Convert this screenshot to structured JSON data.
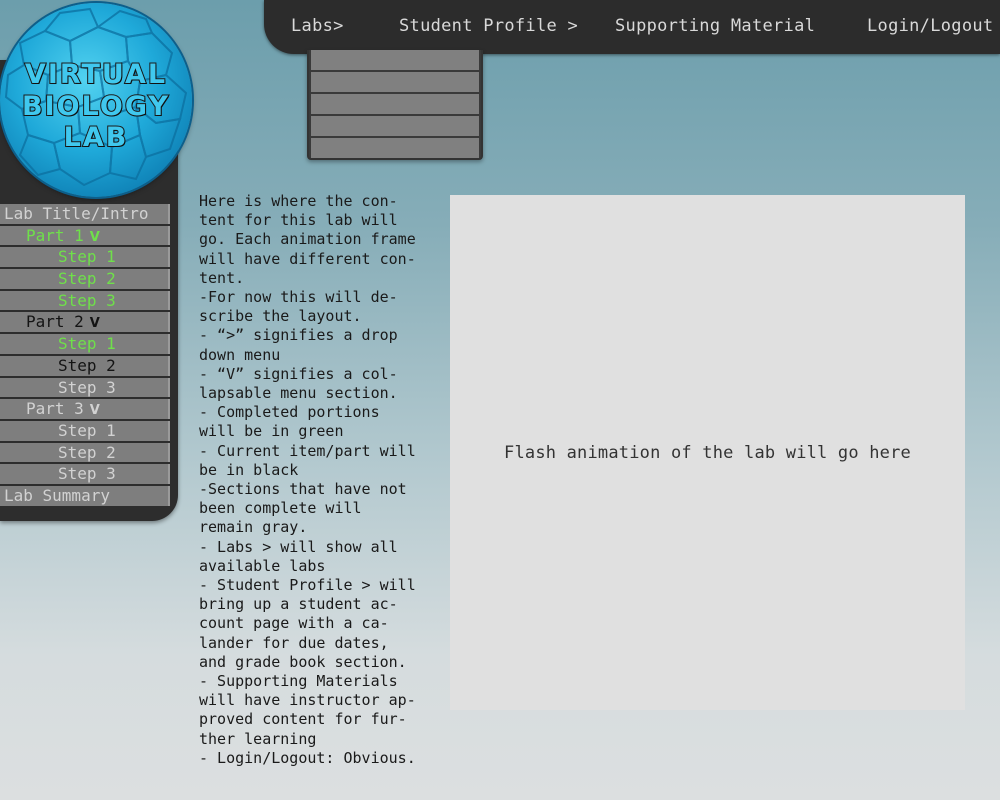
{
  "nav": {
    "labs": "Labs>",
    "student_profile": "Student Profile >",
    "supporting_material": "Supporting Material",
    "login": "Login/Logout"
  },
  "logo": {
    "line1": "VIRTUAL",
    "line2": "BIOLOGY",
    "line3": "LAB"
  },
  "menu": [
    {
      "label": "Lab Title/Intro",
      "level": "title",
      "status": "pending",
      "chevron": ""
    },
    {
      "label": "Part 1",
      "level": "part",
      "status": "complete",
      "chevron": "V"
    },
    {
      "label": "Step 1",
      "level": "step",
      "status": "complete",
      "chevron": ""
    },
    {
      "label": "Step 2",
      "level": "step",
      "status": "complete",
      "chevron": ""
    },
    {
      "label": "Step 3",
      "level": "step",
      "status": "complete",
      "chevron": ""
    },
    {
      "label": "Part 2",
      "level": "part",
      "status": "current",
      "chevron": "V"
    },
    {
      "label": "Step 1",
      "level": "step",
      "status": "complete",
      "chevron": ""
    },
    {
      "label": "Step 2",
      "level": "step",
      "status": "current",
      "chevron": ""
    },
    {
      "label": "Step 3",
      "level": "step",
      "status": "pending",
      "chevron": ""
    },
    {
      "label": "Part 3",
      "level": "part",
      "status": "pending",
      "chevron": "V"
    },
    {
      "label": "Step 1",
      "level": "step",
      "status": "pending",
      "chevron": ""
    },
    {
      "label": "Step 2",
      "level": "step",
      "status": "pending",
      "chevron": ""
    },
    {
      "label": "Step 3",
      "level": "step",
      "status": "pending",
      "chevron": ""
    },
    {
      "label": "Lab Summary",
      "level": "title",
      "status": "pending",
      "chevron": ""
    }
  ],
  "description": [
    "Here is where the con-",
    "tent for this lab will",
    "go. Each animation frame",
    "will have different con-",
    "tent.",
    "-For now this will de-",
    "scribe the layout.",
    "- “>” signifies a drop",
    "down menu",
    "- “V” signifies a col-",
    "lapsable menu section.",
    "- Completed portions",
    "will be in green",
    "- Current item/part will",
    "be in black",
    "-Sections that have not",
    "been complete will",
    "remain gray.",
    "- Labs > will show all",
    "available labs",
    "- Student Profile > will",
    "bring up a student ac-",
    "count page with a ca-",
    "lander for due dates,",
    "and grade book section.",
    "- Supporting Materials",
    "will have instructor ap-",
    "proved content for fur-",
    "ther learning",
    "- Login/Logout: Obvious."
  ],
  "flash_label": "Flash animation of the lab will go here",
  "colors": {
    "complete": "#6fe04a",
    "current": "#141414",
    "pending": "#d2d2d2",
    "panel": "#2d2d2d",
    "logo": "#1fa9d9"
  }
}
